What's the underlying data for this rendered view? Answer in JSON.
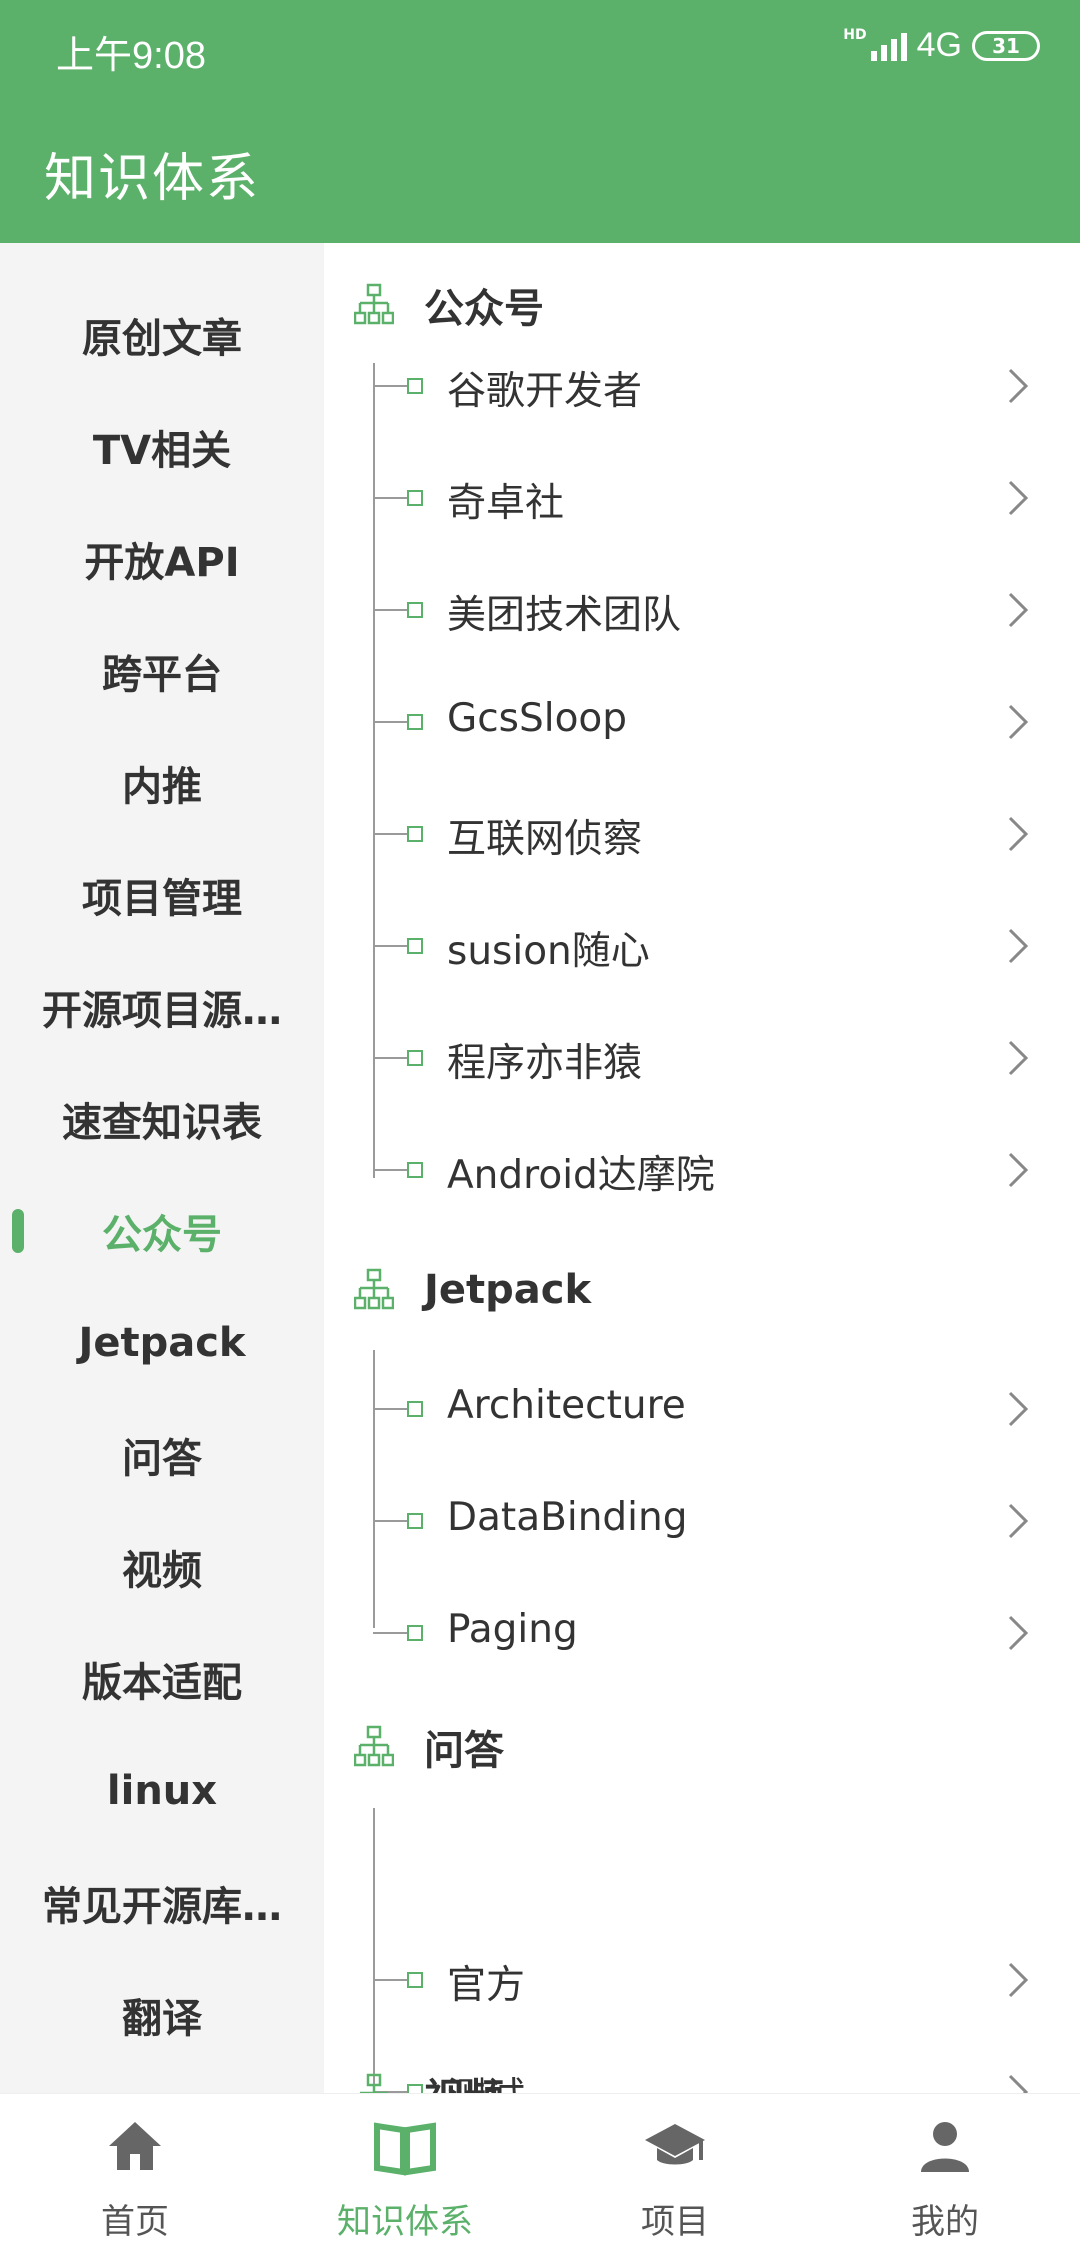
{
  "status_bar": {
    "time": "上午9:08",
    "hd": "HD",
    "network": "4G",
    "battery": "31"
  },
  "app_bar": {
    "title": "知识体系"
  },
  "colors": {
    "accent": "#5BB06A",
    "sidebar_bg": "#F4F4F4",
    "text": "#333333"
  },
  "sidebar": {
    "items": [
      {
        "label": "原创文章"
      },
      {
        "label": "TV相关"
      },
      {
        "label": "开放API"
      },
      {
        "label": "跨平台"
      },
      {
        "label": "内推"
      },
      {
        "label": "项目管理"
      },
      {
        "label": "开源项目源…"
      },
      {
        "label": "速查知识表"
      },
      {
        "label": "公众号",
        "active": true
      },
      {
        "label": "Jetpack"
      },
      {
        "label": "问答"
      },
      {
        "label": "视频"
      },
      {
        "label": "版本适配"
      },
      {
        "label": "linux"
      },
      {
        "label": "常见开源库…"
      },
      {
        "label": "翻译"
      }
    ]
  },
  "content": {
    "sections": [
      {
        "title": "公众号",
        "icon": "tree-structure-icon",
        "items": [
          {
            "label": "谷歌开发者"
          },
          {
            "label": "奇卓社"
          },
          {
            "label": "美团技术团队"
          },
          {
            "label": "GcsSloop"
          },
          {
            "label": "互联网侦察"
          },
          {
            "label": "susion随心"
          },
          {
            "label": "程序亦非猿"
          },
          {
            "label": "Android达摩院"
          }
        ]
      },
      {
        "title": "Jetpack",
        "icon": "tree-structure-icon",
        "items": [
          {
            "label": "Architecture"
          },
          {
            "label": "DataBinding"
          },
          {
            "label": "Paging"
          }
        ]
      },
      {
        "title": "问答",
        "icon": "tree-structure-icon",
        "items": [
          {
            "label": "官方"
          },
          {
            "label": "测试"
          }
        ]
      },
      {
        "title": "视频",
        "icon": "tree-structure-icon",
        "items": []
      }
    ]
  },
  "bottom_nav": {
    "items": [
      {
        "label": "首页",
        "icon": "home-icon"
      },
      {
        "label": "知识体系",
        "icon": "book-icon",
        "active": true
      },
      {
        "label": "项目",
        "icon": "graduation-cap-icon"
      },
      {
        "label": "我的",
        "icon": "person-icon"
      }
    ]
  }
}
